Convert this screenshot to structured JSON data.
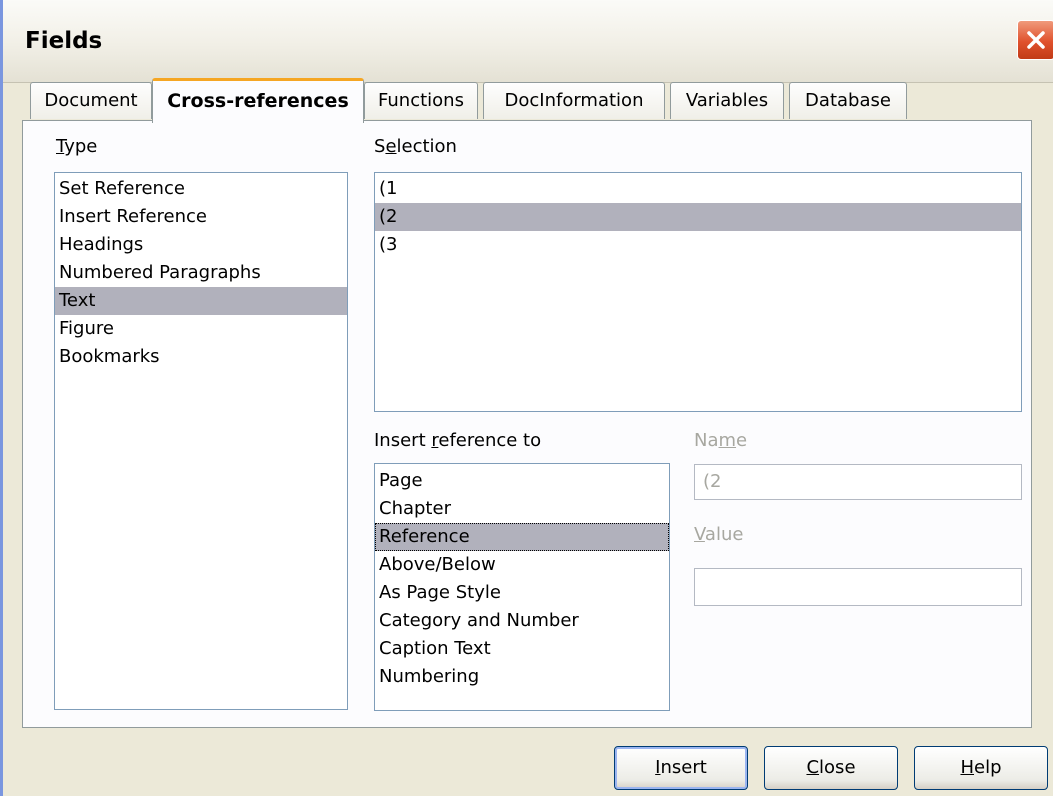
{
  "window": {
    "title": "Fields"
  },
  "tabs": [
    "Document",
    "Cross-references",
    "Functions",
    "DocInformation",
    "Variables",
    "Database"
  ],
  "type": {
    "label_prefix": "",
    "label_mnemonic": "T",
    "label_rest": "ype",
    "items": [
      "Set Reference",
      "Insert Reference",
      "Headings",
      "Numbered Paragraphs",
      "Text",
      "Figure",
      "Bookmarks"
    ],
    "selected": "Text"
  },
  "selection": {
    "label_prefix": "S",
    "label_mnemonic": "e",
    "label_rest": "lection",
    "items": [
      "(1",
      "(2",
      "(3"
    ],
    "selected": "(2"
  },
  "insert_ref": {
    "label_prefix": "Insert ",
    "label_mnemonic": "r",
    "label_rest": "eference to",
    "items": [
      "Page",
      "Chapter",
      "Reference",
      "Above/Below",
      "As Page Style",
      "Category and Number",
      "Caption Text",
      "Numbering"
    ],
    "selected": "Reference"
  },
  "name": {
    "label_prefix": "Na",
    "label_mnemonic": "m",
    "label_rest": "e",
    "value": "(2"
  },
  "value": {
    "label_prefix": "",
    "label_mnemonic": "V",
    "label_rest": "alue",
    "value": ""
  },
  "buttons": {
    "insert": {
      "mnemonic": "I",
      "rest": "nsert"
    },
    "close": {
      "mnemonic": "C",
      "rest": "lose"
    },
    "help": {
      "mnemonic": "H",
      "rest": "elp"
    }
  },
  "colors": {
    "selected_bg": "#b1b1bc",
    "active_tab_accent": "#f5a623",
    "close_button": "#e0512c"
  }
}
